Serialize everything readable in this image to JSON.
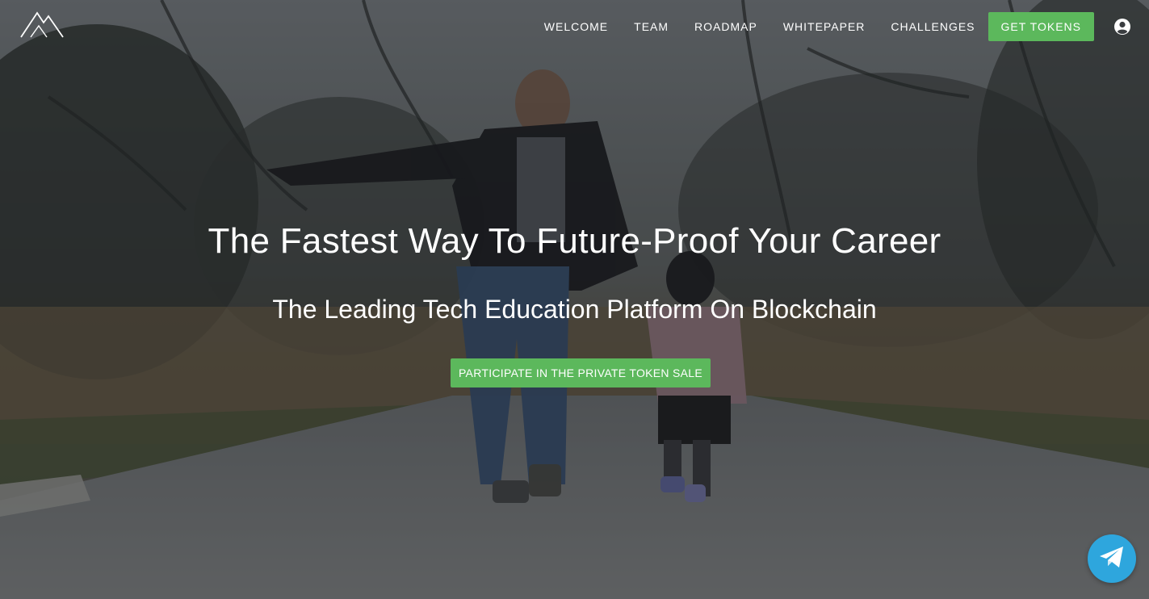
{
  "nav": {
    "logo_icon": "mountain-logo-icon",
    "items": [
      {
        "label": "WELCOME"
      },
      {
        "label": "TEAM"
      },
      {
        "label": "ROADMAP"
      },
      {
        "label": "WHITEPAPER"
      },
      {
        "label": "CHALLENGES"
      }
    ],
    "cta_label": "GET TOKENS",
    "account_icon": "user-circle-icon"
  },
  "hero": {
    "title": "The Fastest Way To Future-Proof Your Career",
    "subtitle": "The Leading Tech Education Platform On Blockchain",
    "button_label": "PARTICIPATE IN THE PRIVATE TOKEN SALE",
    "background_image": "father-and-daughter-walking-on-path"
  },
  "floating": {
    "telegram_icon": "telegram-icon"
  },
  "colors": {
    "accent_green": "#5cb85c",
    "telegram_blue": "#2ea6dd",
    "text": "#ffffff"
  }
}
